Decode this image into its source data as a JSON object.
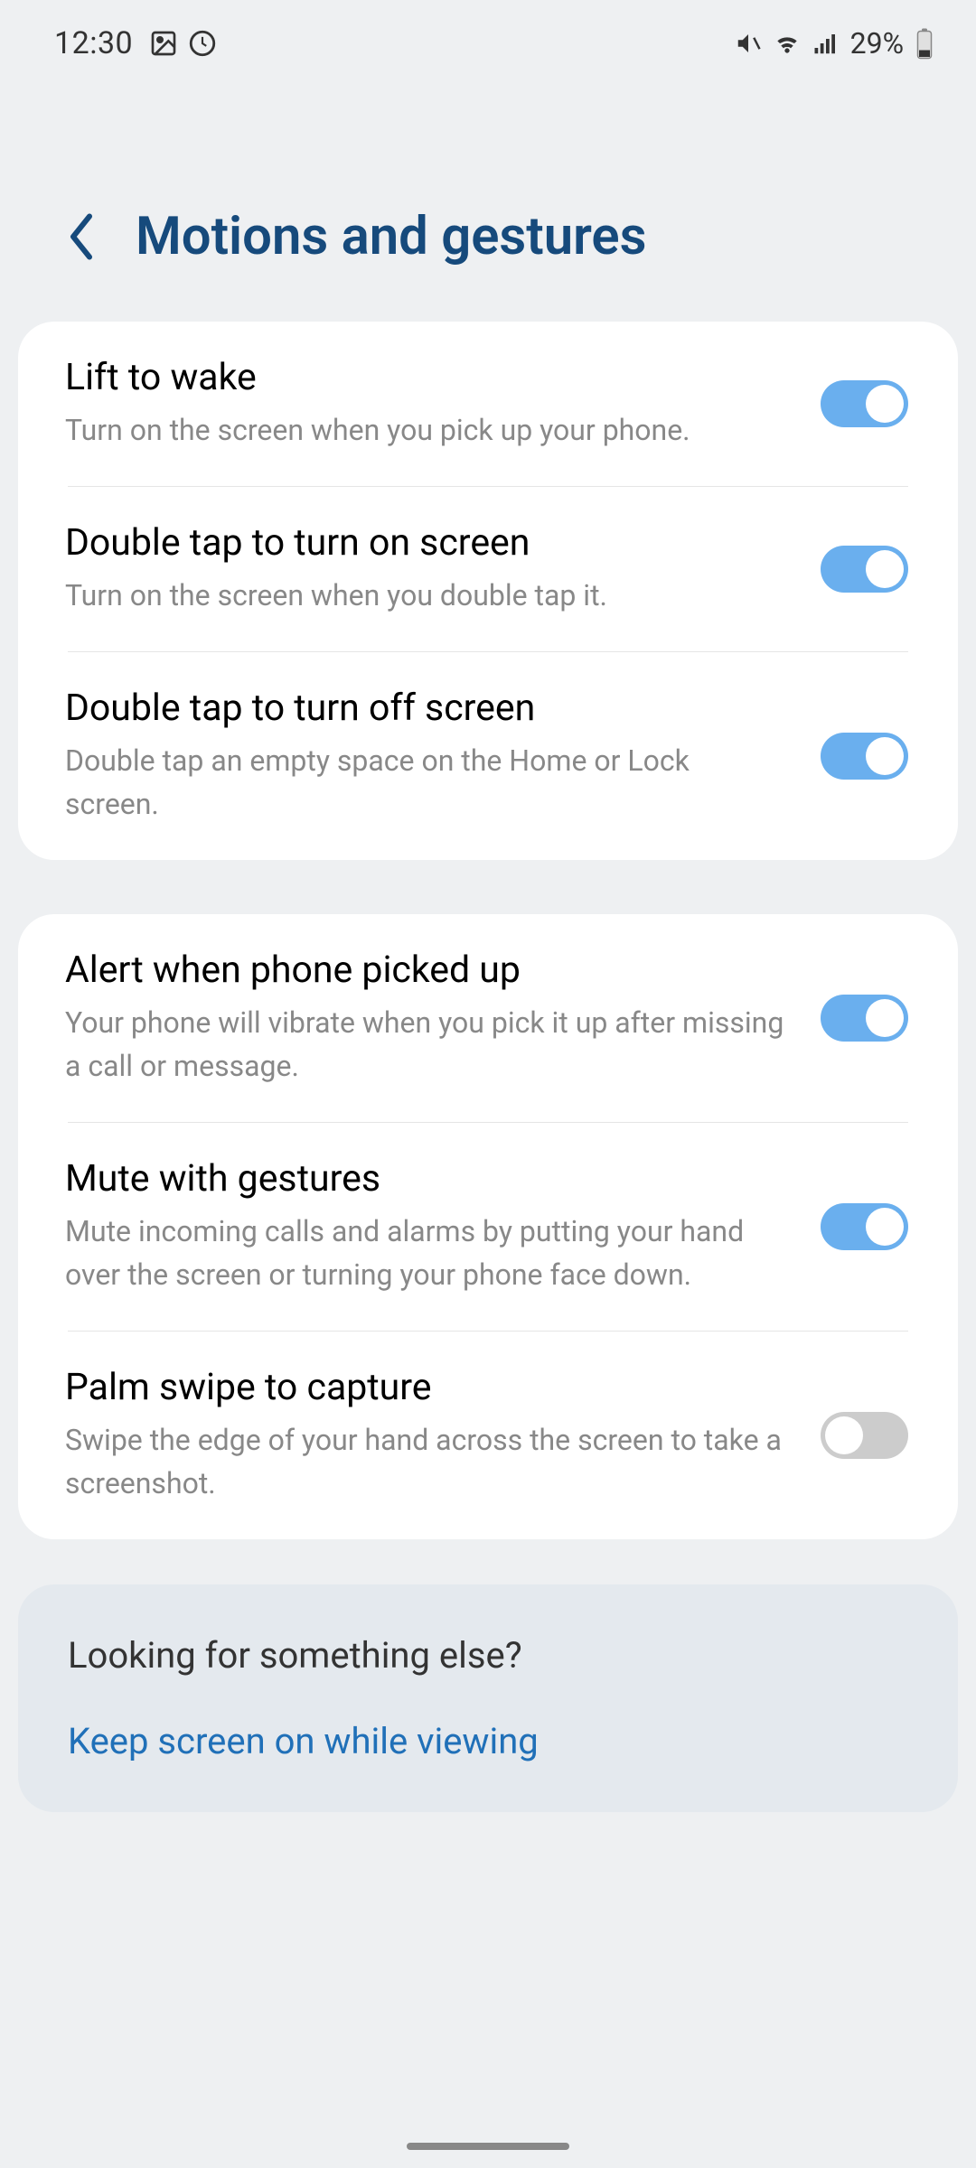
{
  "status": {
    "time": "12:30",
    "battery": "29%"
  },
  "header": {
    "title": "Motions and gestures"
  },
  "sections": [
    {
      "items": [
        {
          "title": "Lift to wake",
          "desc": "Turn on the screen when you pick up your phone.",
          "on": true
        },
        {
          "title": "Double tap to turn on screen",
          "desc": "Turn on the screen when you double tap it.",
          "on": true
        },
        {
          "title": "Double tap to turn off screen",
          "desc": "Double tap an empty space on the Home or Lock screen.",
          "on": true
        }
      ]
    },
    {
      "items": [
        {
          "title": "Alert when phone picked up",
          "desc": "Your phone will vibrate when you pick it up after missing a call or message.",
          "on": true
        },
        {
          "title": "Mute with gestures",
          "desc": "Mute incoming calls and alarms by putting your hand over the screen or turning your phone face down.",
          "on": true
        },
        {
          "title": "Palm swipe to capture",
          "desc": "Swipe the edge of your hand across the screen to take a screenshot.",
          "on": false
        }
      ]
    }
  ],
  "footer": {
    "title": "Looking for something else?",
    "link": "Keep screen on while viewing"
  }
}
